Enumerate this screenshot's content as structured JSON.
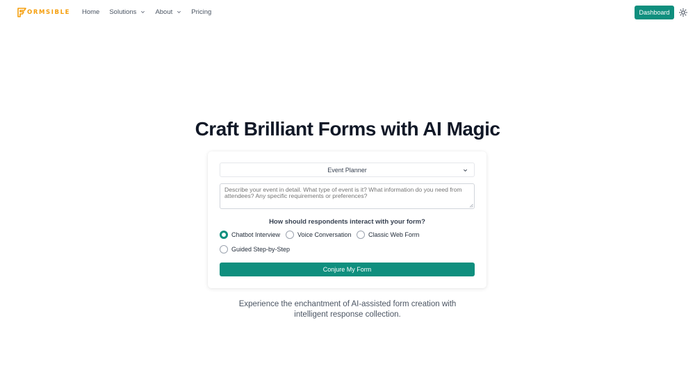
{
  "header": {
    "logo_text": "ORMSIBLE",
    "nav": [
      {
        "label": "Home",
        "has_dropdown": false
      },
      {
        "label": "Solutions",
        "has_dropdown": true
      },
      {
        "label": "About",
        "has_dropdown": true
      },
      {
        "label": "Pricing",
        "has_dropdown": false
      }
    ],
    "dashboard_label": "Dashboard",
    "theme_icon": "sun-icon"
  },
  "main": {
    "title": "Craft Brilliant Forms with AI Magic",
    "form": {
      "template_select": {
        "value": "Event Planner"
      },
      "description": {
        "value": "",
        "placeholder": "Describe your event in detail. What type of event is it? What information do you need from attendees? Any specific requirements or preferences?"
      },
      "question": "How should respondents interact with your form?",
      "options": [
        {
          "label": "Chatbot Interview",
          "selected": true
        },
        {
          "label": "Voice Conversation",
          "selected": false
        },
        {
          "label": "Classic Web Form",
          "selected": false
        },
        {
          "label": "Guided Step-by-Step",
          "selected": false
        }
      ],
      "submit_label": "Conjure My Form"
    },
    "tagline": "Experience the enchantment of AI-assisted form creation with intelligent response collection."
  },
  "colors": {
    "accent": "#0f8f7e",
    "logo": "#f59e0b",
    "title": "#111827",
    "muted": "#4b5563"
  }
}
